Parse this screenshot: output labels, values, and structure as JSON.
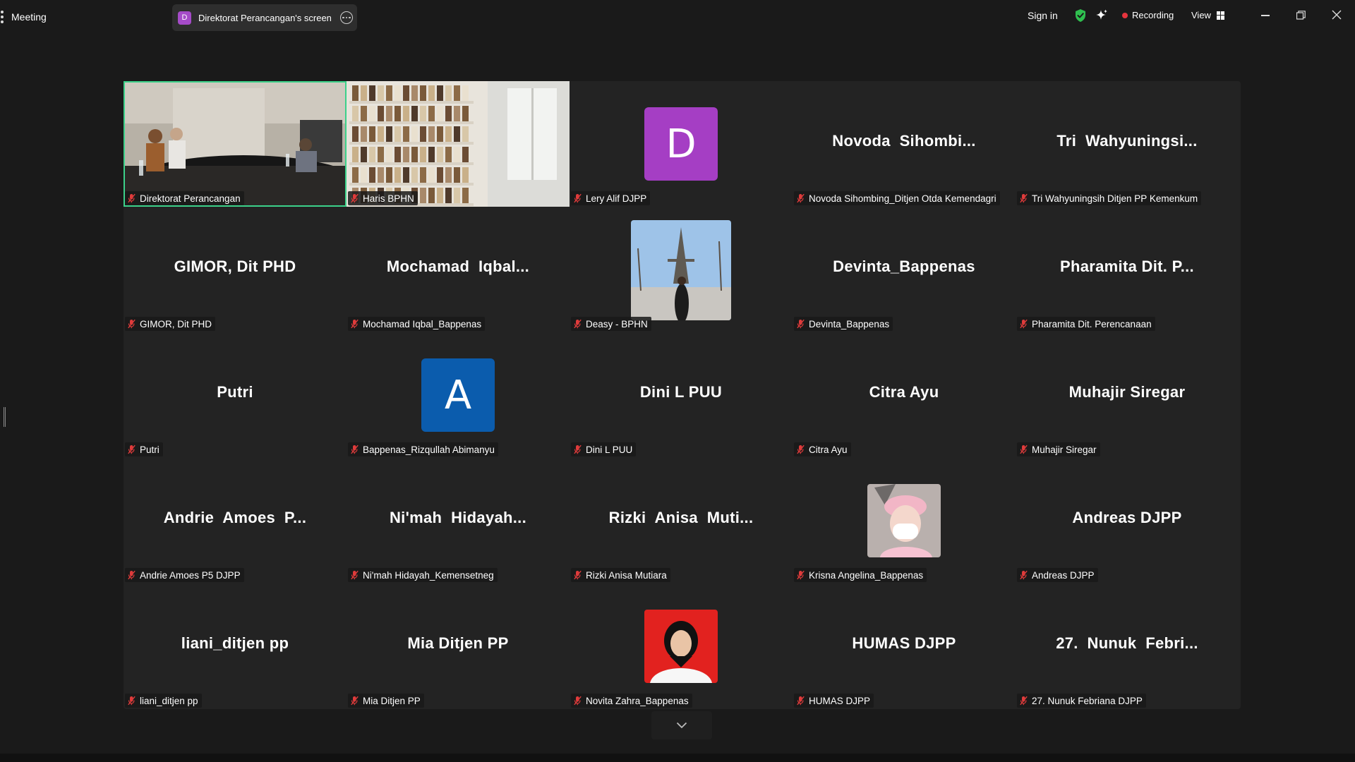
{
  "topbar": {
    "meeting_label": "Meeting",
    "share_pill": {
      "avatar_letter": "D",
      "label": "Direktorat Perancangan's screen"
    },
    "signin_label": "Sign in",
    "recording_label": "Recording",
    "view_label": "View",
    "colors": {
      "shield": "#2fbf4f",
      "recording_dot": "#e5343d",
      "share_avatar": "#a54bc8"
    }
  },
  "tiles": [
    {
      "label": "Direktorat Perancangan",
      "kind": "video-room",
      "active": true
    },
    {
      "label": "Haris BPHN",
      "kind": "video-bookshelf"
    },
    {
      "label": "Lery Alif DJPP",
      "kind": "avatar-letter",
      "letter": "D",
      "color": "#a53ec4"
    },
    {
      "label": "Novoda Sihombing_Ditjen Otda Kemendagri",
      "kind": "name",
      "name": "Novoda  Sihombi..."
    },
    {
      "label": "Tri Wahyuningsih Ditjen PP Kemenkum",
      "kind": "name",
      "name": "Tri  Wahyuningsi..."
    },
    {
      "label": "GIMOR, Dit PHD",
      "kind": "name",
      "name": "GIMOR, Dit PHD"
    },
    {
      "label": "Mochamad Iqbal_Bappenas",
      "kind": "name",
      "name": "Mochamad  Iqbal..."
    },
    {
      "label": "Deasy - BPHN",
      "kind": "photo-eiffel"
    },
    {
      "label": "Devinta_Bappenas",
      "kind": "name",
      "name": "Devinta_Bappenas"
    },
    {
      "label": "Pharamita Dit. Perencanaan",
      "kind": "name",
      "name": "Pharamita Dit. P..."
    },
    {
      "label": "Putri",
      "kind": "name",
      "name": "Putri"
    },
    {
      "label": "Bappenas_Rizqullah Abimanyu",
      "kind": "avatar-letter",
      "letter": "A",
      "color": "#0b5cad"
    },
    {
      "label": "Dini L PUU",
      "kind": "name",
      "name": "Dini L PUU"
    },
    {
      "label": "Citra Ayu",
      "kind": "name",
      "name": "Citra Ayu"
    },
    {
      "label": "Muhajir Siregar",
      "kind": "name",
      "name": "Muhajir Siregar"
    },
    {
      "label": "Andrie Amoes P5 DJPP",
      "kind": "name",
      "name": "Andrie  Amoes  P..."
    },
    {
      "label": "Ni'mah Hidayah_Kemensetneg",
      "kind": "name",
      "name": "Ni'mah  Hidayah..."
    },
    {
      "label": "Rizki Anisa Mutiara",
      "kind": "name",
      "name": "Rizki  Anisa  Muti..."
    },
    {
      "label": "Krisna Angelina_Bappenas",
      "kind": "photo-pink"
    },
    {
      "label": "Andreas DJPP",
      "kind": "name",
      "name": "Andreas DJPP"
    },
    {
      "label": "liani_ditjen pp",
      "kind": "name",
      "name": "liani_ditjen pp"
    },
    {
      "label": "Mia Ditjen PP",
      "kind": "name",
      "name": "Mia Ditjen PP"
    },
    {
      "label": "Novita Zahra_Bappenas",
      "kind": "photo-red"
    },
    {
      "label": "HUMAS DJPP",
      "kind": "name",
      "name": "HUMAS DJPP"
    },
    {
      "label": "27. Nunuk Febriana DJPP",
      "kind": "name",
      "name": "27.  Nunuk  Febri..."
    }
  ]
}
